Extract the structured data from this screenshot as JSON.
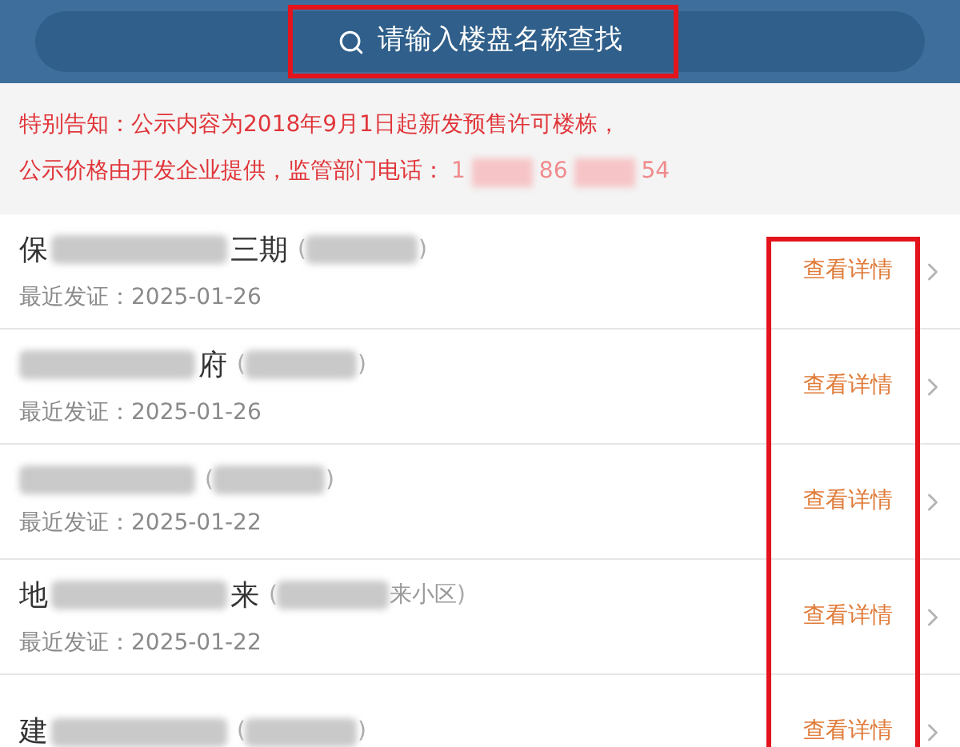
{
  "search": {
    "placeholder": "请输入楼盘名称查找"
  },
  "notice": {
    "lines": [
      "特别告知：公示内容为2018年9月1日起新发预售许可楼栋，",
      "公示价格由开发企业提供，监管部门电话："
    ],
    "phone_parts": [
      "1",
      "86",
      "54"
    ]
  },
  "projects": [
    {
      "name_head": "保",
      "name_tail": "三期",
      "note_open": "(",
      "note_close": ")",
      "issued": "最近发证：2025-01-26",
      "action": "查看详情"
    },
    {
      "name_tail": "府",
      "note_open": "(",
      "note_close": ")",
      "issued": "最近发证：2025-01-26",
      "action": "查看详情"
    },
    {
      "note_open": "(",
      "note_close": ")",
      "issued": "最近发证：2025-01-22",
      "action": "查看详情"
    },
    {
      "name_head": "地",
      "name_tail": "来",
      "note_open": "(",
      "note_tail": "来小区",
      "note_close": ")",
      "issued": "最近发证：2025-01-22",
      "action": "查看详情"
    },
    {
      "name_head": "建",
      "note_open": "(",
      "note_close": ")",
      "action": "查看详情"
    }
  ]
}
